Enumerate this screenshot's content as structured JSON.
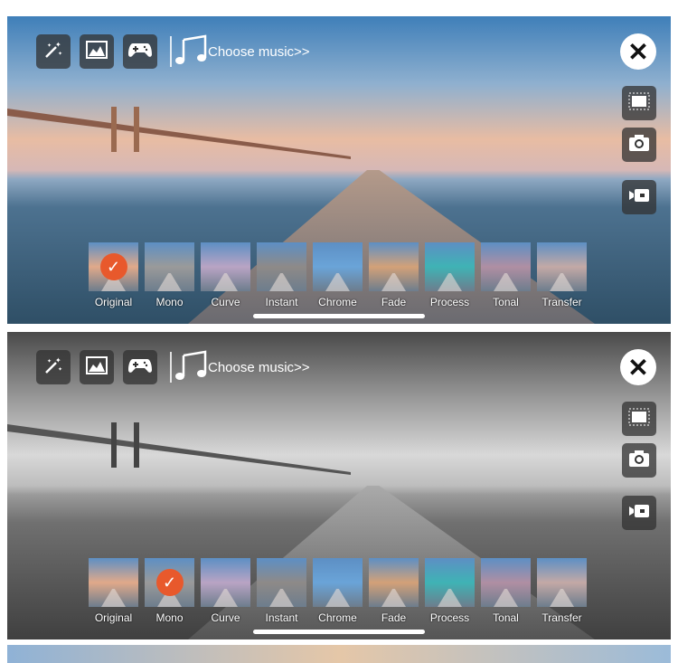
{
  "toolbar": {
    "icons": [
      "magic-wand-icon",
      "image-icon",
      "gamepad-icon"
    ],
    "music_icon": "music-note-icon",
    "music_label": "Choose music>>"
  },
  "side": {
    "close_icon": "close-icon",
    "buttons": [
      "crop-frame-icon",
      "camera-icon",
      "video-icon"
    ]
  },
  "filters": [
    "Original",
    "Mono",
    "Curve",
    "Instant",
    "Chrome",
    "Fade",
    "Process",
    "Tonal",
    "Transfer"
  ],
  "filter_colors": [
    "#e0a98a",
    "#9a9a9a",
    "#b9a4c4",
    "#8e8a88",
    "#6aa4d8",
    "#d3a178",
    "#3fb3b5",
    "#b08fa3",
    "#c3a9a6"
  ],
  "panels": [
    {
      "selected_filter": "Original"
    },
    {
      "selected_filter": "Mono"
    }
  ],
  "accent": "#e8592c"
}
